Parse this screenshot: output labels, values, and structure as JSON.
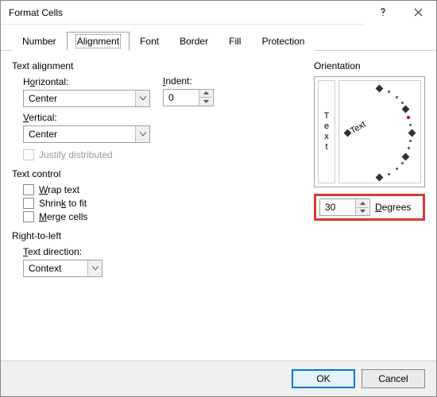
{
  "window": {
    "title": "Format Cells"
  },
  "tabs": [
    {
      "label": "Number"
    },
    {
      "label": "Alignment",
      "active": true
    },
    {
      "label": "Font"
    },
    {
      "label": "Border"
    },
    {
      "label": "Fill"
    },
    {
      "label": "Protection"
    }
  ],
  "alignment": {
    "section_title": "Text alignment",
    "horizontal_label_pre": "H",
    "horizontal_label_u": "o",
    "horizontal_label_post": "rizontal:",
    "horizontal_value": "Center",
    "indent_label_u": "I",
    "indent_label_post": "ndent:",
    "indent_value": "0",
    "vertical_label_u": "V",
    "vertical_label_post": "ertical:",
    "vertical_value": "Center",
    "justify_label": "Justify distributed"
  },
  "text_control": {
    "section_title": "Text control",
    "wrap_u": "W",
    "wrap_post": "rap text",
    "shrink_pre": "Shrin",
    "shrink_u": "k",
    "shrink_post": " to fit",
    "merge_u": "M",
    "merge_post": "erge cells"
  },
  "rtl": {
    "section_title": "Right-to-left",
    "dir_label_u": "T",
    "dir_label_post": "ext direction:",
    "dir_value": "Context"
  },
  "orientation": {
    "section_title": "Orientation",
    "vertical_text": "Text",
    "dial_text": "Text",
    "degrees_value": "30",
    "degrees_label_u": "D",
    "degrees_label_post": "egrees"
  },
  "buttons": {
    "ok": "OK",
    "cancel": "Cancel"
  }
}
